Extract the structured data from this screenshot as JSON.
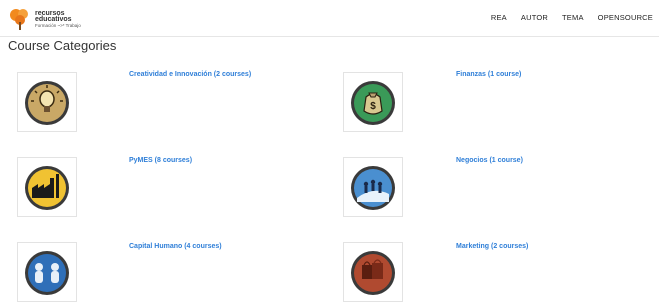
{
  "header": {
    "logo": {
      "line1": "recursos",
      "line2": "educativos",
      "line3": "Formación ~>* Trabajo",
      "icon": "orange-tree-logo-icon"
    },
    "nav": [
      {
        "label": "REA"
      },
      {
        "label": "AUTOR"
      },
      {
        "label": "TEMA"
      },
      {
        "label": "OPENSOURCE"
      }
    ]
  },
  "main": {
    "title": "Course Categories",
    "categories": [
      {
        "label": "Creatividad e Innovación (2 courses)",
        "icon": "lightbulb-icon",
        "color": "#b89a5a"
      },
      {
        "label": "Finanzas (1 course)",
        "icon": "money-bag-icon",
        "color": "#2e8b4a"
      },
      {
        "label": "PyMES (8 courses)",
        "icon": "factory-icon",
        "color": "#e8b82a"
      },
      {
        "label": "Negocios (1 course)",
        "icon": "business-people-icon",
        "color": "#3a7fc0"
      },
      {
        "label": "Capital Humano (4 courses)",
        "icon": "people-group-icon",
        "color": "#2a6ab0"
      },
      {
        "label": "Marketing (2 courses)",
        "icon": "shopping-bags-icon",
        "color": "#a8412a"
      }
    ]
  },
  "colors": {
    "link": "#2f7fd8",
    "text": "#333333"
  }
}
